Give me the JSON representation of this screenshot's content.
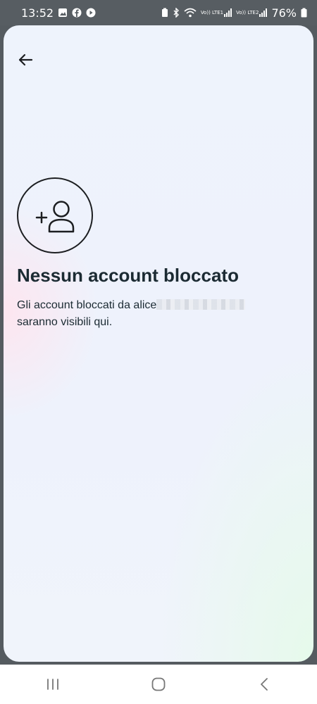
{
  "status_bar": {
    "time": "13:52",
    "battery": "76%",
    "left_icons": [
      "gallery-icon",
      "facebook-icon",
      "play-icon"
    ],
    "right_icons": [
      "battery-saver-icon",
      "bluetooth-icon",
      "wifi-icon",
      "signal-lte1-icon",
      "signal-lte2-icon",
      "battery-icon"
    ],
    "signal_labels": [
      "Vo)) LTE1",
      "Vo)) LTE2"
    ]
  },
  "header": {
    "back_icon": "arrow-left-icon"
  },
  "empty_state": {
    "icon": "add-person-icon",
    "title": "Nessun account bloccato",
    "description_prefix": "Gli account bloccati da alice",
    "description_suffix": "saranno visibili qui."
  },
  "nav_bar": {
    "icons": [
      "recents-icon",
      "home-icon",
      "back-icon"
    ]
  }
}
